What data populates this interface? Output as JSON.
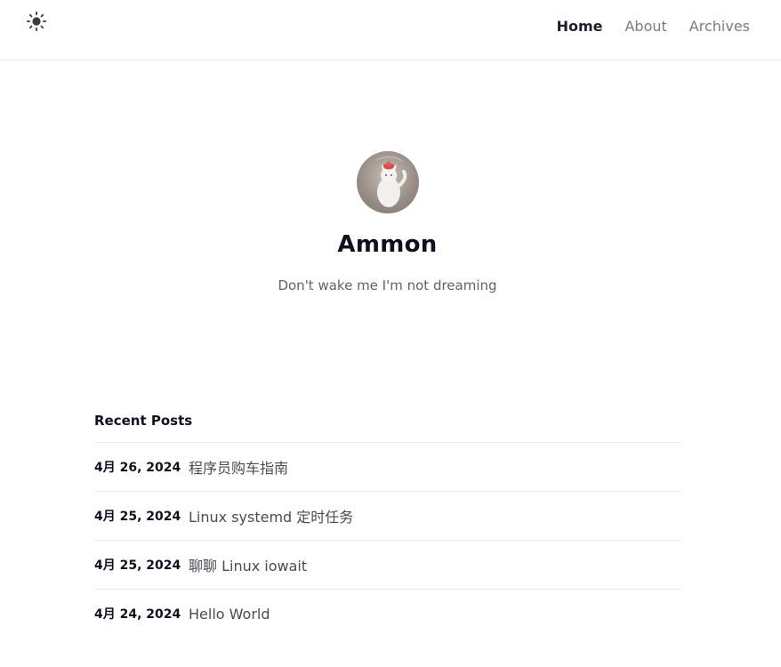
{
  "header": {
    "theme_toggle_icon": "sun-icon",
    "nav": [
      {
        "label": "Home",
        "active": true
      },
      {
        "label": "About",
        "active": false
      },
      {
        "label": "Archives",
        "active": false
      }
    ]
  },
  "profile": {
    "avatar_icon": "cat-avatar",
    "name": "Ammon",
    "tagline": "Don't wake me I'm not dreaming"
  },
  "recent": {
    "title": "Recent Posts",
    "posts": [
      {
        "date": "4月 26, 2024",
        "title": "程序员购车指南"
      },
      {
        "date": "4月 25, 2024",
        "title": "Linux systemd 定时任务"
      },
      {
        "date": "4月 25, 2024",
        "title": "聊聊 Linux iowait"
      },
      {
        "date": "4月 24, 2024",
        "title": "Hello World"
      }
    ]
  }
}
